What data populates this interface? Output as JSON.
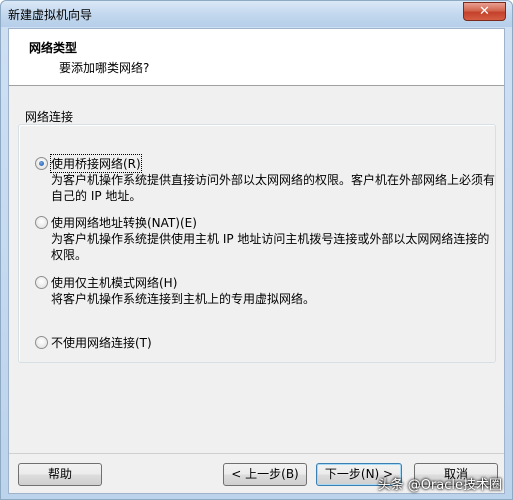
{
  "window": {
    "title": "新建虚拟机向导",
    "close_glyph": "✕"
  },
  "header": {
    "title": "网络类型",
    "subtitle": "要添加哪类网络?"
  },
  "group": {
    "label": "网络连接",
    "options": [
      {
        "label": "使用桥接网络(R)",
        "checked": true,
        "description": "为客户机操作系统提供直接访问外部以太网网络的权限。客户机在外部网络上必须有自己的 IP 地址。"
      },
      {
        "label": "使用网络地址转换(NAT)(E)",
        "checked": false,
        "description": "为客户机操作系统提供使用主机 IP 地址访问主机拨号连接或外部以太网网络连接的权限。"
      },
      {
        "label": "使用仅主机模式网络(H)",
        "checked": false,
        "description": "将客户机操作系统连接到主机上的专用虚拟网络。"
      },
      {
        "label": "不使用网络连接(T)",
        "checked": false,
        "description": ""
      }
    ]
  },
  "buttons": {
    "help": "帮助",
    "back": "< 上一步(B)",
    "next": "下一步(N) >",
    "cancel": "取消"
  },
  "watermark": "头条 @Oracle技术圈"
}
